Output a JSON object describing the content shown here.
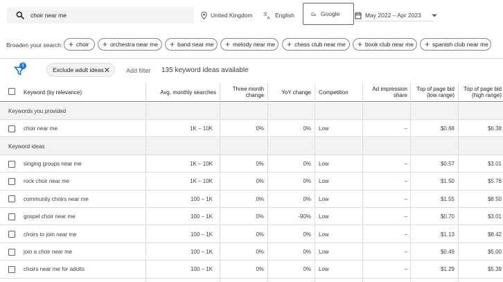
{
  "search": {
    "query": "choir near me"
  },
  "location": "United Kingdom",
  "language": "English",
  "network": "Google",
  "date_range": "May 2022 – Apr 2023",
  "broaden": {
    "label": "Broaden your search:",
    "chips": [
      "choir",
      "orchestra near me",
      "band near me",
      "melody near me",
      "chess club near me",
      "book club near me",
      "spanish club near me"
    ]
  },
  "filters": {
    "badge_count": "1",
    "active_filter": "Exclude adult ideas",
    "add_filter": "Add filter",
    "ideas_count": "135 keyword ideas available"
  },
  "table": {
    "headers": {
      "keyword": "Keyword (by relevance)",
      "avg": "Avg. monthly searches",
      "three_month_l1": "Three month",
      "three_month_l2": "change",
      "yoy": "YoY change",
      "competition": "Competition",
      "ad_imp_l1": "Ad impression",
      "ad_imp_l2": "share",
      "bid_low_l1": "Top of page bid",
      "bid_low_l2": "(low range)",
      "bid_high_l1": "Top of page bid",
      "bid_high_l2": "(high range)"
    },
    "section_provided": "Keywords you provided",
    "section_ideas": "Keyword ideas",
    "provided": [
      {
        "keyword": "choir near me",
        "avg": "1K – 10K",
        "three_month": "0%",
        "yoy": "0%",
        "competition": "Low",
        "ad_imp": "–",
        "bid_low": "$0.68",
        "bid_high": "$6.38"
      }
    ],
    "ideas": [
      {
        "keyword": "singing groups near me",
        "avg": "1K – 10K",
        "three_month": "0%",
        "yoy": "0%",
        "competition": "Low",
        "ad_imp": "–",
        "bid_low": "$0.57",
        "bid_high": "$3.01"
      },
      {
        "keyword": "rock choir near me",
        "avg": "1K – 10K",
        "three_month": "0%",
        "yoy": "0%",
        "competition": "Low",
        "ad_imp": "–",
        "bid_low": "$1.50",
        "bid_high": "$5.76"
      },
      {
        "keyword": "community choirs near me",
        "avg": "100 – 1K",
        "three_month": "0%",
        "yoy": "0%",
        "competition": "Low",
        "ad_imp": "–",
        "bid_low": "$1.55",
        "bid_high": "$8.50"
      },
      {
        "keyword": "gospel choir near me",
        "avg": "100 – 1K",
        "three_month": "0%",
        "yoy": "-90%",
        "competition": "Low",
        "ad_imp": "–",
        "bid_low": "$0.70",
        "bid_high": "$3.01"
      },
      {
        "keyword": "choirs to join near me",
        "avg": "100 – 1K",
        "three_month": "0%",
        "yoy": "0%",
        "competition": "Low",
        "ad_imp": "–",
        "bid_low": "$1.13",
        "bid_high": "$8.42"
      },
      {
        "keyword": "join a choir near me",
        "avg": "100 – 1K",
        "three_month": "0%",
        "yoy": "0%",
        "competition": "Low",
        "ad_imp": "–",
        "bid_low": "$0.49",
        "bid_high": "$5.00"
      },
      {
        "keyword": "choirs near me for adults",
        "avg": "100 – 1K",
        "three_month": "0%",
        "yoy": "0%",
        "competition": "Low",
        "ad_imp": "–",
        "bid_low": "$1.29",
        "bid_high": "$5.39"
      }
    ]
  },
  "colors": {
    "accent": "#1a73e8",
    "section_bg": "#f1f3f4",
    "border": "#dadce0"
  }
}
